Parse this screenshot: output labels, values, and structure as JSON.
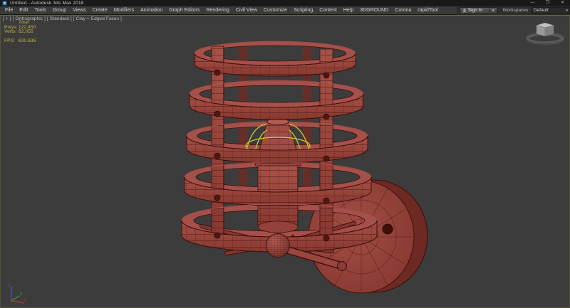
{
  "window": {
    "title": "Untitled - Autodesk 3ds Max 2018",
    "controls": {
      "minimize_icon": "—",
      "maximize_icon": "❐",
      "close_icon": "✕"
    }
  },
  "menu_bar": {
    "items": [
      "File",
      "Edit",
      "Tools",
      "Group",
      "Views",
      "Create",
      "Modifiers",
      "Animation",
      "Graph Editors",
      "Rendering",
      "Civil View",
      "Customize",
      "Scripting",
      "Content",
      "Help",
      "3DGROUND",
      "Corona",
      "rapidTool"
    ],
    "sign_in": {
      "icon": "person-icon",
      "label": "Sign In",
      "caret": "▾"
    },
    "workspaces": {
      "label": "Workspaces:",
      "value": "Default",
      "caret": "▾"
    }
  },
  "viewport": {
    "labels": [
      "[ + ]",
      "[ Orthographic ]",
      "[ Standard ]",
      "[ Clay + Edged Faces ]"
    ],
    "statistics": {
      "header": "Total",
      "polys_label": "Polys:",
      "polys_value": "122,450",
      "verts_label": "Verts:",
      "verts_value": "62,055",
      "fps_label": "FPS:",
      "fps_value": "630.636"
    },
    "axis_gizmo": {
      "x": "x",
      "y": "y",
      "z": "z"
    },
    "model": {
      "description": "Wall-mounted lantern sconce, cylindrical cage of five rings with riveted posts, inner bulb, spoked base, round wall plate",
      "display_mode": "Clay + Edged Faces"
    },
    "colors": {
      "viewport_background": "#3c3c3c",
      "active_border": "#6b683c",
      "clay_base": "#9c4841",
      "clay_light": "#b05a52",
      "clay_dark": "#6f2a24",
      "edge": "#42120e",
      "selection_yellow": "#d2c833",
      "stats_text": "#c9b63b"
    }
  }
}
